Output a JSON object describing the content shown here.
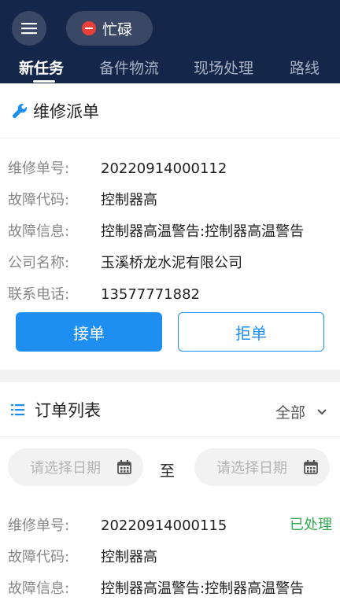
{
  "header": {
    "status_label": "忙碌",
    "tabs": [
      "新任务",
      "备件物流",
      "现场处理",
      "路线"
    ]
  },
  "dispatch": {
    "title": "维修派单",
    "fields": [
      {
        "label": "维修单号:",
        "value": "20220914000112"
      },
      {
        "label": "故障代码:",
        "value": "控制器高"
      },
      {
        "label": "故障信息:",
        "value": "控制器高温警告:控制器高温警告"
      },
      {
        "label": "公司名称:",
        "value": "玉溪桥龙水泥有限公司"
      },
      {
        "label": "联系电话:",
        "value": "13577771882"
      }
    ],
    "accept_label": "接单",
    "reject_label": "拒单"
  },
  "orders": {
    "title": "订单列表",
    "filter_label": "全部",
    "date_placeholder": "请选择日期",
    "date_separator": "至",
    "items": [
      {
        "status": "已处理",
        "fields": [
          {
            "label": "维修单号:",
            "value": "20220914000115"
          },
          {
            "label": "故障代码:",
            "value": "控制器高"
          },
          {
            "label": "故障信息:",
            "value": "控制器高温警告:控制器高温警告"
          }
        ]
      }
    ]
  },
  "colors": {
    "header_bg": "#14264a",
    "accent": "#1f8ef1",
    "busy_red": "#e8413a",
    "done_green": "#2ea84f"
  },
  "icons": [
    "menu-icon",
    "busy-icon",
    "wrench-icon",
    "list-icon",
    "chevron-down-icon",
    "calendar-icon"
  ]
}
